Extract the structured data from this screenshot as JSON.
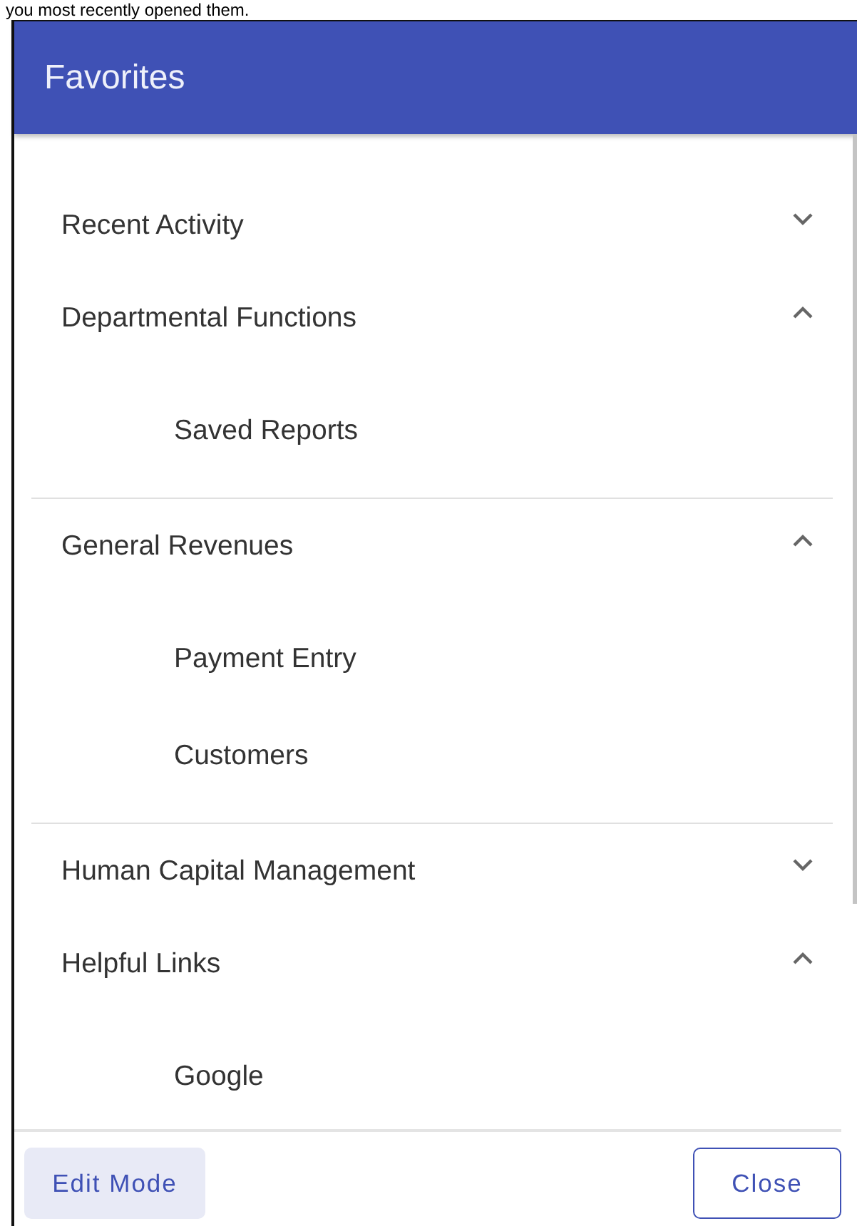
{
  "page_text": "you most recently opened them.",
  "dialog": {
    "title": "Favorites"
  },
  "groups": [
    {
      "label": "Recent Activity",
      "expanded": false
    },
    {
      "label": "Departmental Functions",
      "expanded": true,
      "children": [
        {
          "label": "Saved Reports"
        }
      ]
    },
    {
      "label": "General Revenues",
      "expanded": true,
      "children": [
        {
          "label": "Payment Entry"
        },
        {
          "label": "Customers"
        }
      ]
    },
    {
      "label": "Human Capital Management",
      "expanded": false
    },
    {
      "label": "Helpful Links",
      "expanded": true,
      "children": [
        {
          "label": "Google"
        }
      ]
    }
  ],
  "buttons": [
    {
      "label": "Edit Mode",
      "kind": "tonal"
    },
    {
      "label": "Close",
      "kind": "outlined"
    }
  ]
}
